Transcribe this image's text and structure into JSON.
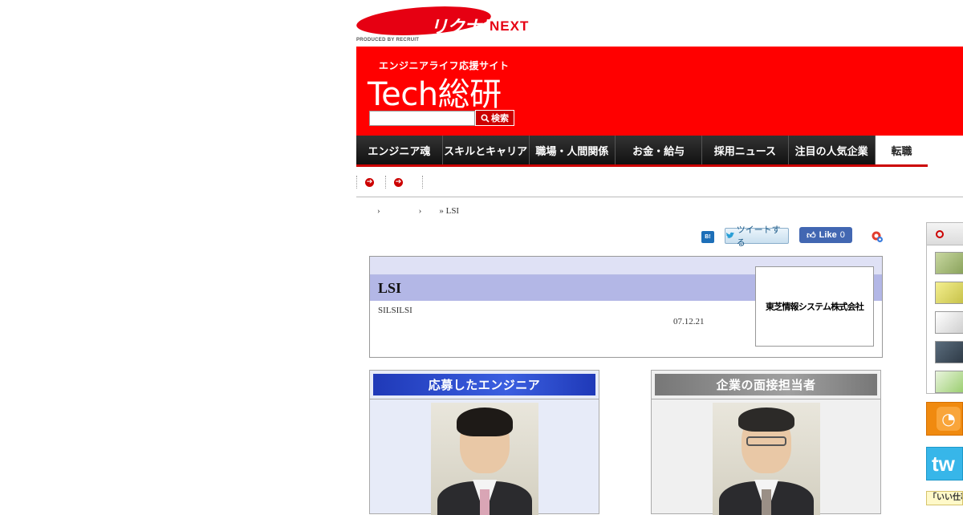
{
  "header": {
    "logo_kana": "リクナビ",
    "logo_suffix": "NEXT",
    "produced_by": "PRODUCED BY RECRUIT"
  },
  "banner": {
    "tagline": "エンジニアライフ応援サイト",
    "site_title": "Tech総研",
    "search_placeholder": "",
    "search_button": "検索"
  },
  "nav": {
    "items": [
      {
        "label": "エンジニア魂"
      },
      {
        "label": "スキルとキャリア"
      },
      {
        "label": "職場・人間関係"
      },
      {
        "label": "お金・給与"
      },
      {
        "label": "採用ニュース"
      },
      {
        "label": "注目の人気企業"
      },
      {
        "label": "転職"
      }
    ]
  },
  "breadcrumb": {
    "current": "LSI"
  },
  "social": {
    "hatena_label": "B!",
    "tweet_label": "ツイートする",
    "like_label": "Like",
    "like_count": "0"
  },
  "article": {
    "title": "LSI",
    "subtitle": "SILSILSI",
    "date": "07.12.21",
    "company_logo_text": "東芝情報システム株式会社"
  },
  "panels": {
    "left_heading": "応募したエンジニア",
    "right_heading": "企業の面接担当者"
  },
  "sidebar": {
    "bottom_label": "「いい仕事"
  },
  "colors": {
    "brand_red": "#ff0000",
    "nav_bg": "#1e1e1e",
    "article_header": "#b3b7e6",
    "engineer_panel": "#1f39b8",
    "interviewer_panel": "#888888"
  }
}
